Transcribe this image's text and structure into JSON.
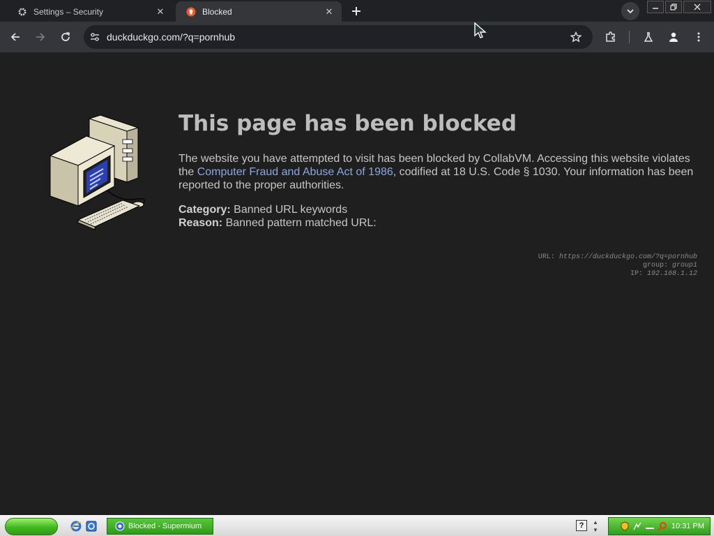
{
  "tabs": [
    {
      "label": "Settings – Security",
      "icon": "gear-icon",
      "active": false
    },
    {
      "label": "Blocked",
      "icon": "brave-icon",
      "active": true
    }
  ],
  "address_bar": {
    "url": "duckduckgo.com/?q=pornhub"
  },
  "page": {
    "title": "This page has been blocked",
    "desc_part1": "The website you have attempted to visit has been blocked by CollabVM. Accessing this website violates the ",
    "law_link": "Computer Fraud and Abuse Act of 1986",
    "desc_part2": ", codified at 18 U.S. Code § 1030. Your information has been reported to the proper authorities.",
    "category_label": "Category:",
    "category_value": "Banned URL keywords",
    "reason_label": "Reason:",
    "reason_value": "Banned pattern matched URL:",
    "tech": {
      "url_label": "URL:",
      "url_value": "https://duckduckgo.com/?q=pornhub",
      "group_label": "group:",
      "group_value": "group1",
      "ip_label": "IP:",
      "ip_value": "192.168.1.12"
    }
  },
  "taskbar": {
    "task_item_label": "Blocked - Supermium",
    "help_label": "?",
    "clock": "10:31 PM"
  },
  "colors": {
    "page_bg": "#1f1f1f",
    "link": "#8aa8e0",
    "taskbar_green": "#3fb81f"
  }
}
